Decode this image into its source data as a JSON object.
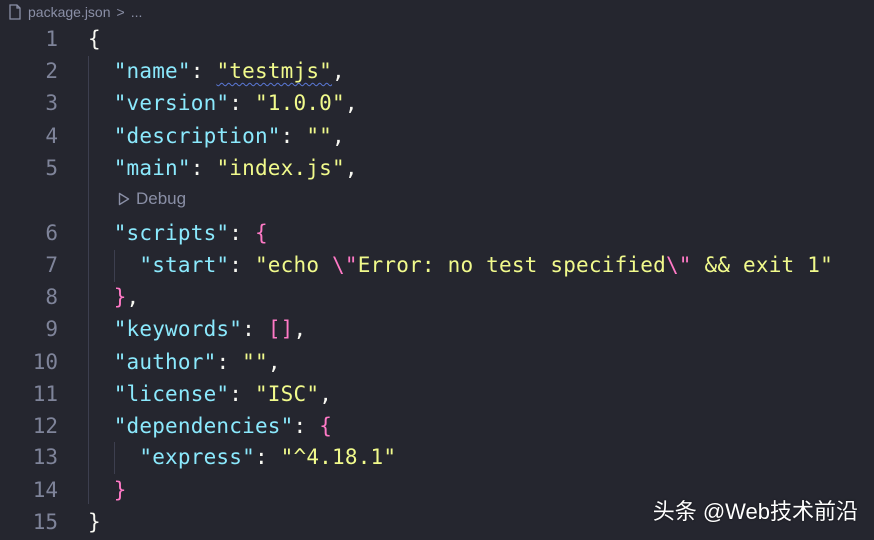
{
  "breadcrumb": {
    "file_icon": "file-icon",
    "filename": "package.json",
    "separator": ">",
    "more": "..."
  },
  "codelens": {
    "icon": "play-outline-icon",
    "label": "Debug"
  },
  "lines": [
    {
      "num": "1",
      "tokens": [
        {
          "t": "{",
          "c": "pun"
        }
      ]
    },
    {
      "num": "2",
      "tokens": [
        {
          "t": "  ",
          "c": "pun"
        },
        {
          "t": "\"name\"",
          "c": "key"
        },
        {
          "t": ": ",
          "c": "pun"
        },
        {
          "t": "\"testmjs\"",
          "c": "str",
          "squiggle": true
        },
        {
          "t": ",",
          "c": "pun"
        }
      ]
    },
    {
      "num": "3",
      "tokens": [
        {
          "t": "  ",
          "c": "pun"
        },
        {
          "t": "\"version\"",
          "c": "key"
        },
        {
          "t": ": ",
          "c": "pun"
        },
        {
          "t": "\"1.0.0\"",
          "c": "str"
        },
        {
          "t": ",",
          "c": "pun"
        }
      ]
    },
    {
      "num": "4",
      "tokens": [
        {
          "t": "  ",
          "c": "pun"
        },
        {
          "t": "\"description\"",
          "c": "key"
        },
        {
          "t": ": ",
          "c": "pun"
        },
        {
          "t": "\"\"",
          "c": "str"
        },
        {
          "t": ",",
          "c": "pun"
        }
      ]
    },
    {
      "num": "5",
      "tokens": [
        {
          "t": "  ",
          "c": "pun"
        },
        {
          "t": "\"main\"",
          "c": "key"
        },
        {
          "t": ": ",
          "c": "pun"
        },
        {
          "t": "\"index.js\"",
          "c": "str"
        },
        {
          "t": ",",
          "c": "pun"
        }
      ]
    },
    {
      "num": "6",
      "tokens": [
        {
          "t": "  ",
          "c": "pun"
        },
        {
          "t": "\"scripts\"",
          "c": "key"
        },
        {
          "t": ": ",
          "c": "pun"
        },
        {
          "t": "{",
          "c": "br"
        }
      ]
    },
    {
      "num": "7",
      "tokens": [
        {
          "t": "    ",
          "c": "pun"
        },
        {
          "t": "\"start\"",
          "c": "key"
        },
        {
          "t": ": ",
          "c": "pun"
        },
        {
          "t": "\"echo ",
          "c": "str"
        },
        {
          "t": "\\\"",
          "c": "esc"
        },
        {
          "t": "Error: no test specified",
          "c": "str"
        },
        {
          "t": "\\\"",
          "c": "esc"
        },
        {
          "t": " && exit 1\"",
          "c": "str"
        }
      ]
    },
    {
      "num": "8",
      "tokens": [
        {
          "t": "  ",
          "c": "pun"
        },
        {
          "t": "}",
          "c": "br"
        },
        {
          "t": ",",
          "c": "pun"
        }
      ]
    },
    {
      "num": "9",
      "tokens": [
        {
          "t": "  ",
          "c": "pun"
        },
        {
          "t": "\"keywords\"",
          "c": "key"
        },
        {
          "t": ": ",
          "c": "pun"
        },
        {
          "t": "[]",
          "c": "br"
        },
        {
          "t": ",",
          "c": "pun"
        }
      ]
    },
    {
      "num": "10",
      "tokens": [
        {
          "t": "  ",
          "c": "pun"
        },
        {
          "t": "\"author\"",
          "c": "key"
        },
        {
          "t": ": ",
          "c": "pun"
        },
        {
          "t": "\"\"",
          "c": "str"
        },
        {
          "t": ",",
          "c": "pun"
        }
      ]
    },
    {
      "num": "11",
      "tokens": [
        {
          "t": "  ",
          "c": "pun"
        },
        {
          "t": "\"license\"",
          "c": "key"
        },
        {
          "t": ": ",
          "c": "pun"
        },
        {
          "t": "\"ISC\"",
          "c": "str"
        },
        {
          "t": ",",
          "c": "pun"
        }
      ]
    },
    {
      "num": "12",
      "tokens": [
        {
          "t": "  ",
          "c": "pun"
        },
        {
          "t": "\"dependencies\"",
          "c": "key"
        },
        {
          "t": ": ",
          "c": "pun"
        },
        {
          "t": "{",
          "c": "br"
        }
      ]
    },
    {
      "num": "13",
      "tokens": [
        {
          "t": "    ",
          "c": "pun"
        },
        {
          "t": "\"express\"",
          "c": "key"
        },
        {
          "t": ": ",
          "c": "pun"
        },
        {
          "t": "\"^4.18.1\"",
          "c": "str"
        }
      ]
    },
    {
      "num": "14",
      "tokens": [
        {
          "t": "  ",
          "c": "pun"
        },
        {
          "t": "}",
          "c": "br"
        }
      ]
    },
    {
      "num": "15",
      "tokens": [
        {
          "t": "}",
          "c": "pun"
        }
      ]
    }
  ],
  "watermark": "头条 @Web技术前沿",
  "colors": {
    "background": "#25262f",
    "line_number": "#7f849a",
    "key": "#8be9fd",
    "string": "#f1fa8c",
    "bracket": "#ff79c6",
    "punctuation": "#f8f8f2",
    "squiggle": "#5a78d6"
  }
}
